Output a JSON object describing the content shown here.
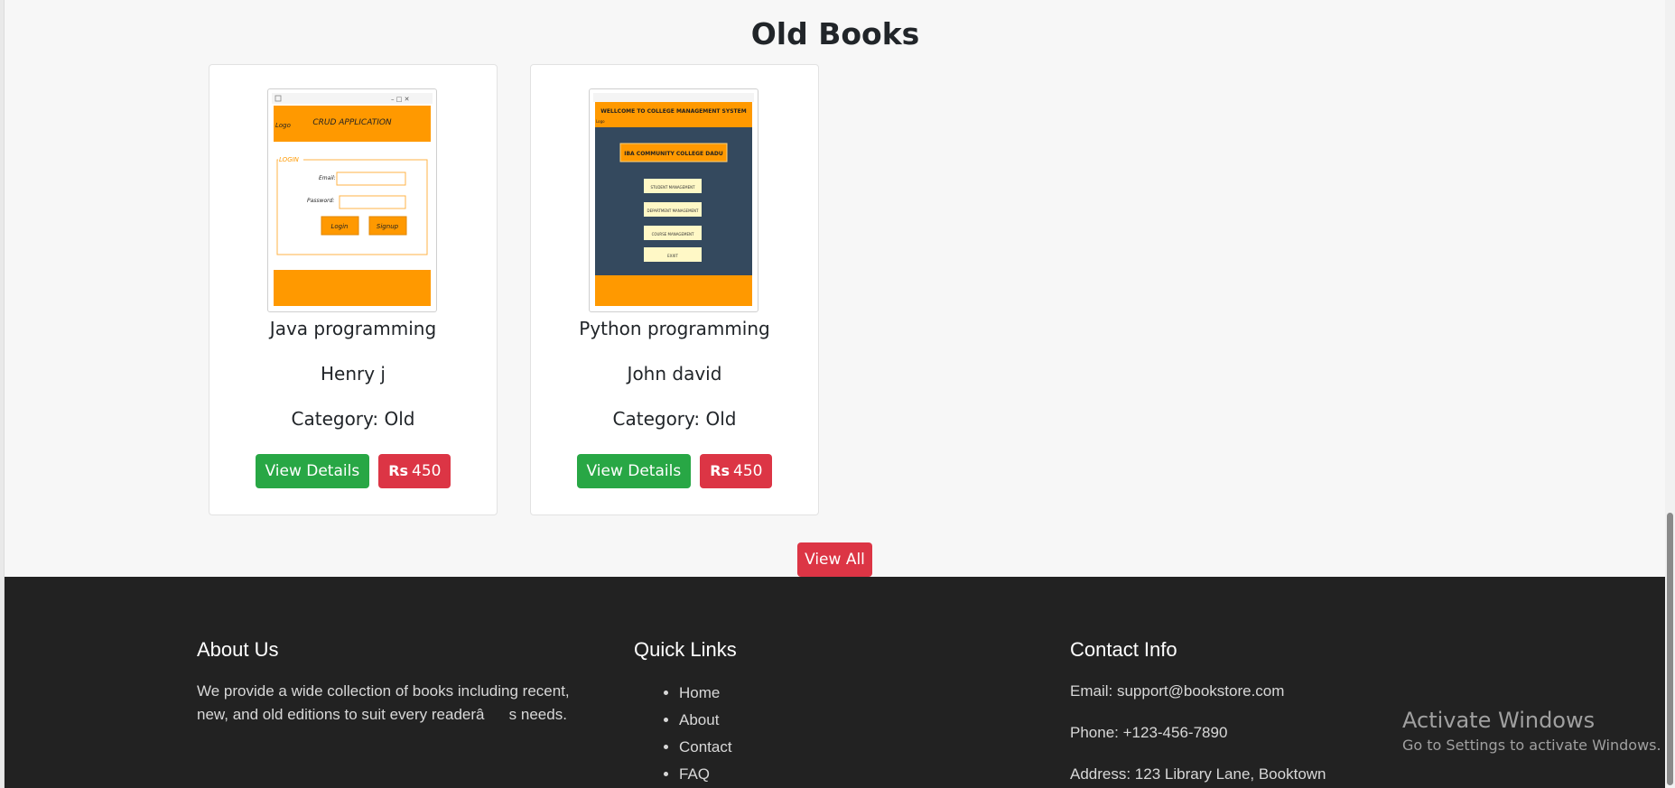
{
  "section": {
    "title": "Old Books"
  },
  "books": [
    {
      "title": "Java programming",
      "author": "Henry j",
      "category": "Category: Old",
      "details_label": "View Details",
      "price_symbol": "Rs",
      "price": "450",
      "cover": {
        "app_title": "CRUD APPLICATION",
        "logo": "Logo",
        "group_label": "LOGIN",
        "email_label": "Email:",
        "password_label": "Password:",
        "login_label": "Login",
        "signup_label": "Signup",
        "accent": "#ff9900"
      }
    },
    {
      "title": "Python programming",
      "author": "John david",
      "category": "Category: Old",
      "details_label": "View Details",
      "price_symbol": "Rs",
      "price": "450",
      "cover": {
        "header": "WELLCOME TO COLLEGE MANAGEMENT SYSTEM",
        "logo": "Logo",
        "college_name": "IBA COMMUNITY COLLEGE DADU",
        "menu": [
          "STUDENT MANAGEMENT",
          "DEPARTMENT MANAGEMENT",
          "COURSE MANAGEMENT",
          "EXXIT"
        ],
        "accent": "#ff9900",
        "panel": "#34495e"
      }
    }
  ],
  "view_all_label": "View All",
  "footer": {
    "about": {
      "heading": "About Us",
      "text": "We provide a wide collection of books including recent, new, and old editions to suit every readerâs needs."
    },
    "quick_links": {
      "heading": "Quick Links",
      "items": [
        "Home",
        "About",
        "Contact",
        "FAQ"
      ]
    },
    "contact": {
      "heading": "Contact Info",
      "email": "Email: support@bookstore.com",
      "phone": "Phone: +123-456-7890",
      "address": "Address: 123 Library Lane, Booktown"
    }
  },
  "watermark": {
    "title": "Activate Windows",
    "subtitle": "Go to Settings to activate Windows."
  },
  "colors": {
    "green": "#28a745",
    "red": "#dc3545",
    "footer_bg": "#222222"
  }
}
